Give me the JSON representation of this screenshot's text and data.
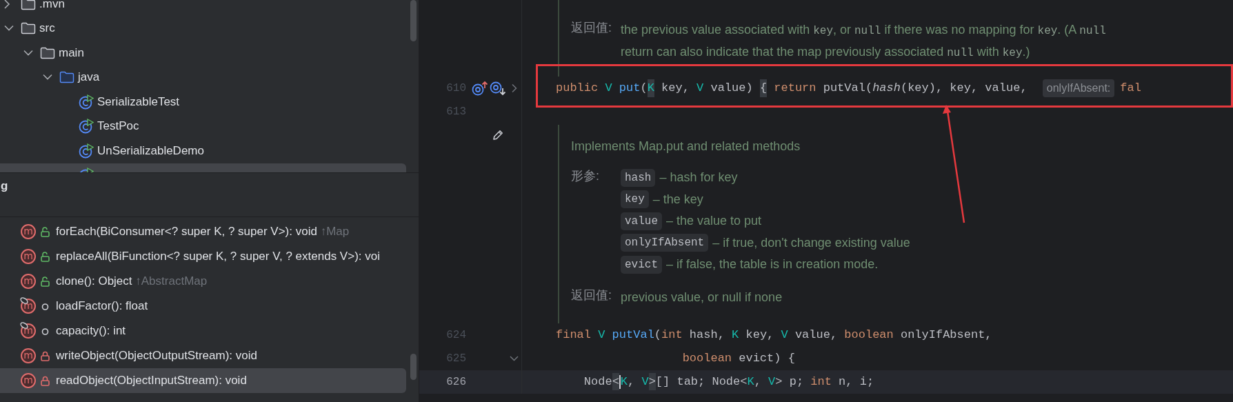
{
  "project_tree": [
    {
      "label": ".mvn",
      "kind": "folder",
      "expanded": false,
      "selected": false
    },
    {
      "label": "src",
      "kind": "folder",
      "expanded": true,
      "selected": false,
      "children": [
        {
          "label": "main",
          "kind": "folder",
          "expanded": true,
          "selected": false,
          "children": [
            {
              "label": "java",
              "kind": "source-folder",
              "expanded": true,
              "selected": false,
              "children": [
                {
                  "label": "SerializableTest",
                  "kind": "class",
                  "selected": false
                },
                {
                  "label": "TestPoc",
                  "kind": "class",
                  "selected": false
                },
                {
                  "label": "UnSerializableDemo",
                  "kind": "class",
                  "selected": false
                },
                {
                  "kind": "class",
                  "selected": true
                }
              ]
            }
          ]
        }
      ]
    }
  ],
  "structure": {
    "title": "g",
    "members": [
      {
        "icon": "m",
        "signature": "forEach(BiConsumer<? super K, ? super V>): void",
        "origin": "↑Map",
        "kind": "public",
        "linked": false,
        "selected": false
      },
      {
        "icon": "m",
        "signature": "replaceAll(BiFunction<? super K, ? super V, ? extends V>): voi",
        "kind": "public",
        "linked": false,
        "selected": false
      },
      {
        "icon": "m",
        "signature": "clone(): Object",
        "origin": "↑AbstractMap",
        "kind": "public",
        "linked": false,
        "selected": false
      },
      {
        "icon": "m",
        "signature": "loadFactor(): float",
        "kind": "package",
        "linked": true,
        "selected": false
      },
      {
        "icon": "m",
        "signature": "capacity(): int",
        "kind": "package",
        "linked": true,
        "selected": false
      },
      {
        "icon": "m",
        "signature": "writeObject(ObjectOutputStream): void",
        "kind": "private",
        "linked": false,
        "selected": false
      },
      {
        "icon": "m",
        "signature": "readObject(ObjectInputStream): void",
        "kind": "private",
        "linked": false,
        "selected": true
      }
    ]
  },
  "editor": {
    "blocks": [
      {
        "kind": "doc",
        "editable": false,
        "returns_label": "返回值:",
        "returns_lines": [
          [
            {
              "text": "the previous value associated with "
            },
            {
              "text": "key",
              "code": true
            },
            {
              "text": ", or "
            },
            {
              "text": "null",
              "code": true
            },
            {
              "text": " if there was no mapping for "
            },
            {
              "text": "key",
              "code": true
            },
            {
              "text": ". (A "
            },
            {
              "text": "null",
              "code": true
            }
          ],
          [
            {
              "text": "return can also indicate that the map previously associated "
            },
            {
              "text": "null",
              "code": true
            },
            {
              "text": " with "
            },
            {
              "text": "key",
              "code": true
            },
            {
              "text": ".)"
            }
          ]
        ]
      },
      {
        "kind": "code",
        "number": "610",
        "gutter_icons": [
          {
            "kind": "override"
          },
          {
            "kind": "implemented"
          }
        ],
        "collapsed": true,
        "annotated": true,
        "current": false,
        "tokens": [
          {
            "kind": "kw",
            "text": "public "
          },
          {
            "kind": "type",
            "text": "V"
          },
          {
            "kind": "fn",
            "text": " put"
          },
          {
            "kind": "plain",
            "text": "("
          },
          {
            "kind": "type",
            "text": "K",
            "boxed": true
          },
          {
            "kind": "plain",
            "text": " key, "
          },
          {
            "kind": "type",
            "text": "V"
          },
          {
            "kind": "plain",
            "text": " value) "
          },
          {
            "kind": "plain",
            "text": "{",
            "boxed": true
          },
          {
            "kind": "kw",
            "text": " return "
          },
          {
            "kind": "plain",
            "text": "putVal("
          },
          {
            "kind": "static",
            "text": "hash"
          },
          {
            "kind": "plain",
            "text": "(key), key, value, "
          },
          {
            "kind": "hint",
            "text": "onlyIfAbsent:"
          },
          {
            "kind": "kw",
            "text": "fal"
          }
        ]
      },
      {
        "kind": "code",
        "number": "613",
        "annotated": false,
        "current": false
      },
      {
        "kind": "doc",
        "editable": true,
        "description": "Implements Map.put and related methods",
        "params_label": "形参:",
        "params": [
          {
            "name": "hash",
            "desc": "– hash for key"
          },
          {
            "name": "key",
            "desc": "– the key"
          },
          {
            "name": "value",
            "desc": "– the value to put"
          },
          {
            "name": "onlyIfAbsent",
            "desc": "– if true, don't change existing value"
          },
          {
            "name": "evict",
            "desc": "– if false, the table is in creation mode."
          }
        ],
        "returns_label": "返回值:",
        "returns_lines": [
          [
            {
              "text": "previous value, or null if none"
            }
          ]
        ]
      },
      {
        "kind": "code",
        "number": "624",
        "annotated": false,
        "current": false,
        "tokens": [
          {
            "kind": "kw",
            "text": "final "
          },
          {
            "kind": "type",
            "text": "V"
          },
          {
            "kind": "fn",
            "text": " putVal"
          },
          {
            "kind": "plain",
            "text": "("
          },
          {
            "kind": "kw",
            "text": "int "
          },
          {
            "kind": "plain",
            "text": "hash, "
          },
          {
            "kind": "type",
            "text": "K"
          },
          {
            "kind": "plain",
            "text": " key, "
          },
          {
            "kind": "type",
            "text": "V"
          },
          {
            "kind": "plain",
            "text": " value, "
          },
          {
            "kind": "kw",
            "text": "boolean "
          },
          {
            "kind": "plain",
            "text": "onlyIfAbsent,"
          }
        ]
      },
      {
        "kind": "code",
        "number": "625",
        "collapsed": false,
        "annotated": false,
        "current": false,
        "tokens": [
          {
            "kind": "kw",
            "text": "                  boolean "
          },
          {
            "kind": "plain",
            "text": "evict) {"
          }
        ]
      },
      {
        "kind": "code",
        "number": "626",
        "annotated": false,
        "current": true,
        "tokens": [
          {
            "kind": "plain",
            "text": "    Node"
          },
          {
            "kind": "plain",
            "text": "<",
            "boxed": true
          },
          {
            "kind": "caret"
          },
          {
            "kind": "type",
            "text": "K"
          },
          {
            "kind": "plain",
            "text": ", "
          },
          {
            "kind": "type",
            "text": "V"
          },
          {
            "kind": "plain",
            "text": ">",
            "boxed": true
          },
          {
            "kind": "plain",
            "text": "[] tab; Node<"
          },
          {
            "kind": "type",
            "text": "K"
          },
          {
            "kind": "plain",
            "text": ", "
          },
          {
            "kind": "type",
            "text": "V"
          },
          {
            "kind": "plain",
            "text": "> p; "
          },
          {
            "kind": "kw",
            "text": "int "
          },
          {
            "kind": "plain",
            "text": "n, i;"
          }
        ]
      }
    ]
  }
}
